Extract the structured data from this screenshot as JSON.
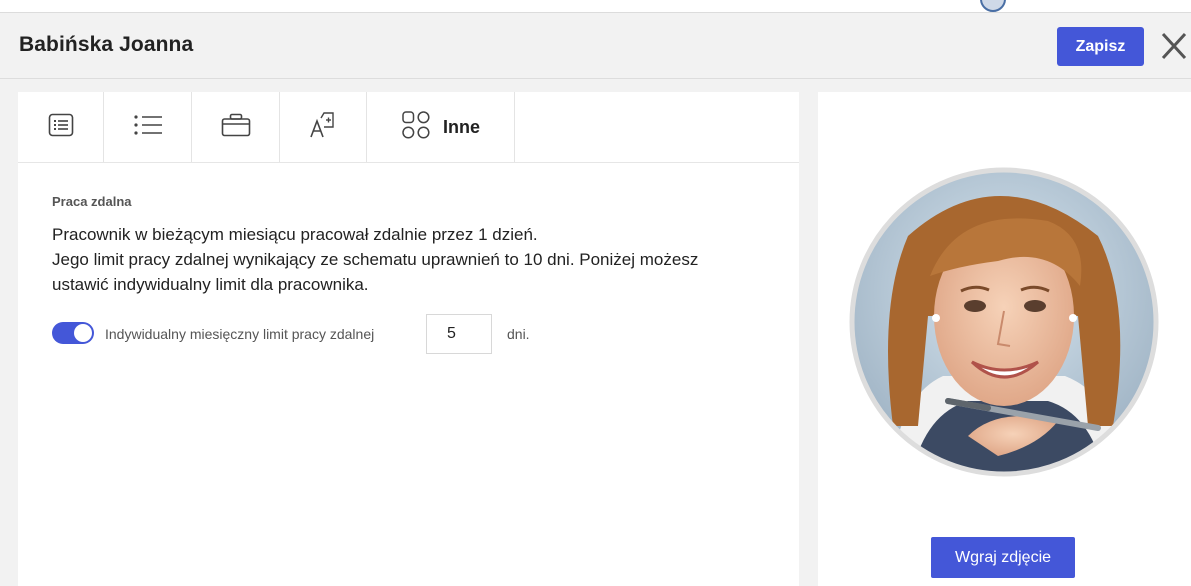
{
  "header": {
    "title": "Babińska Joanna",
    "save_label": "Zapisz"
  },
  "tabs": [
    {
      "icon": "form-list-icon"
    },
    {
      "icon": "bullet-list-icon"
    },
    {
      "icon": "briefcase-icon"
    },
    {
      "icon": "font-size-icon"
    },
    {
      "icon": "apps-grid-icon",
      "label": "Inne"
    }
  ],
  "remote_work": {
    "section_label": "Praca zdalna",
    "line1": "Pracownik w bieżącym miesiącu pracował zdalnie przez 1 dzień.",
    "line2": "Jego limit pracy zdalnej wynikający ze schematu uprawnień to 10 dni. Poniżej możesz",
    "line3": "ustawić indywidualny limit dla pracownika.",
    "toggle_on": true,
    "limit_label": "Indywidualny miesięczny limit pracy zdalnej",
    "limit_value": "5",
    "unit": "dni."
  },
  "photo": {
    "upload_label": "Wgraj zdjęcie"
  },
  "colors": {
    "accent": "#4457d8",
    "background": "#f2f2f2"
  }
}
